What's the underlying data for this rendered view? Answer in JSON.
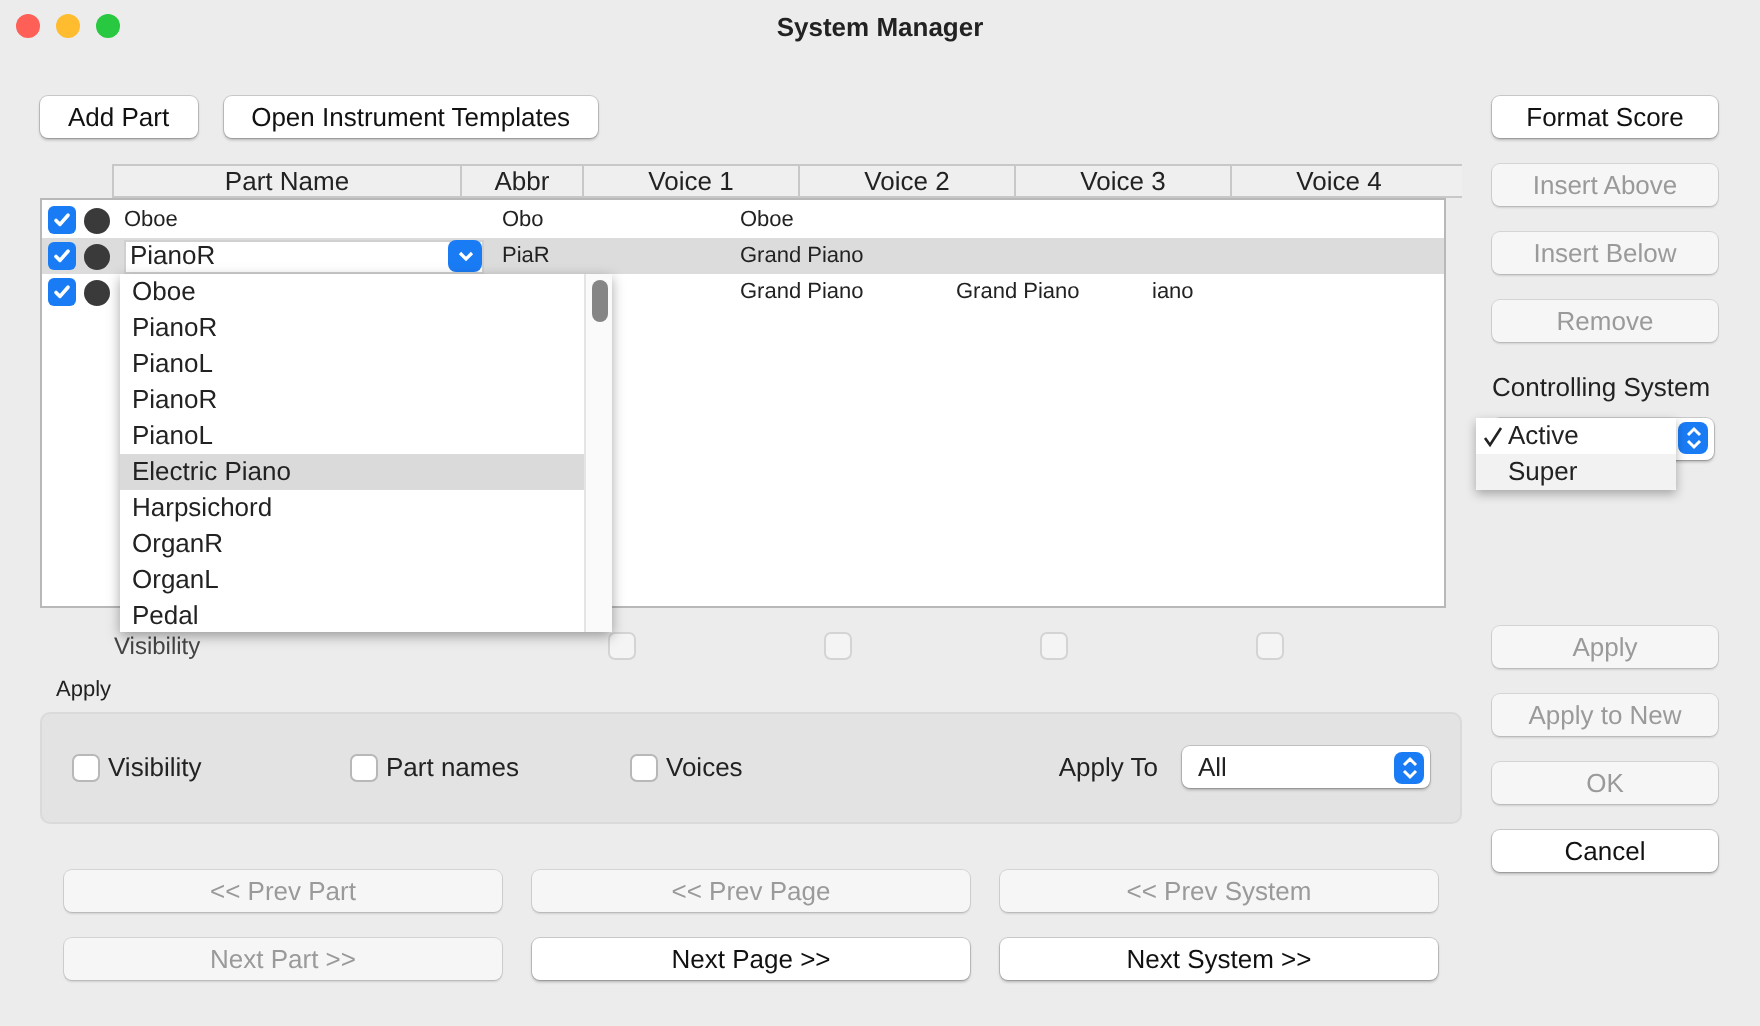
{
  "window": {
    "title": "System Manager"
  },
  "top_buttons": [
    {
      "label": "Add Part",
      "disabled": false
    },
    {
      "label": "Open Instrument Templates",
      "disabled": false
    }
  ],
  "table": {
    "columns": [
      "Part Name",
      "Abbr",
      "Voice 1",
      "Voice 2",
      "Voice 3",
      "Voice 4"
    ],
    "rows": [
      {
        "visible": true,
        "part_name": "Oboe",
        "abbr": "Obo",
        "voices": [
          "Oboe"
        ],
        "selected": false,
        "editing": false
      },
      {
        "visible": true,
        "part_name": "PianoR",
        "abbr": "PiaR",
        "voices": [
          "Grand Piano"
        ],
        "selected": true,
        "editing": true
      },
      {
        "visible": true,
        "voices": [
          "Grand Piano",
          "Grand Piano",
          "iano"
        ],
        "selected": false,
        "editing": false
      }
    ]
  },
  "part_menu": [
    {
      "label": "Oboe",
      "selected": false
    },
    {
      "label": "PianoR",
      "selected": false
    },
    {
      "label": "PianoL",
      "selected": false
    },
    {
      "label": "PianoR",
      "selected": false
    },
    {
      "label": "PianoL",
      "selected": false
    },
    {
      "label": "Electric Piano",
      "selected": true
    },
    {
      "label": "Harpsichord",
      "selected": false
    },
    {
      "label": "OrganR",
      "selected": false
    },
    {
      "label": "OrganL",
      "selected": false
    },
    {
      "label": "Pedal",
      "selected": false
    }
  ],
  "visibility_row": {
    "label": "Visibility",
    "checkboxes": [
      {
        "checked": false,
        "disabled": true
      },
      {
        "checked": false,
        "disabled": true
      },
      {
        "checked": false,
        "disabled": true
      },
      {
        "checked": false,
        "disabled": true
      }
    ]
  },
  "apply": {
    "title": "Apply",
    "options": [
      {
        "label": "Visibility",
        "checked": false
      },
      {
        "label": "Part names",
        "checked": false
      },
      {
        "label": "Voices",
        "checked": false
      }
    ],
    "apply_to": {
      "label": "Apply To",
      "value": "All"
    }
  },
  "nav_buttons": [
    {
      "label": "<< Prev Part",
      "disabled": true
    },
    {
      "label": "<< Prev Page",
      "disabled": true
    },
    {
      "label": "<< Prev System",
      "disabled": true
    },
    {
      "label": "Next Part >>",
      "disabled": true
    },
    {
      "label": "Next Page >>",
      "disabled": false
    },
    {
      "label": "Next System >>",
      "disabled": false
    }
  ],
  "side_buttons": [
    {
      "label": "Format Score",
      "disabled": false
    },
    {
      "label": "Insert Above",
      "disabled": true
    },
    {
      "label": "Insert Below",
      "disabled": true
    },
    {
      "label": "Remove",
      "disabled": true
    }
  ],
  "controlling_system": {
    "label": "Controlling System",
    "options": [
      {
        "label": "Active",
        "selected": true
      },
      {
        "label": "Super",
        "selected": false
      }
    ]
  },
  "lower_side_buttons": [
    {
      "label": "Apply",
      "disabled": true
    },
    {
      "label": "Apply to New",
      "disabled": true
    },
    {
      "label": "OK",
      "disabled": true
    },
    {
      "label": "Cancel",
      "disabled": false
    }
  ]
}
